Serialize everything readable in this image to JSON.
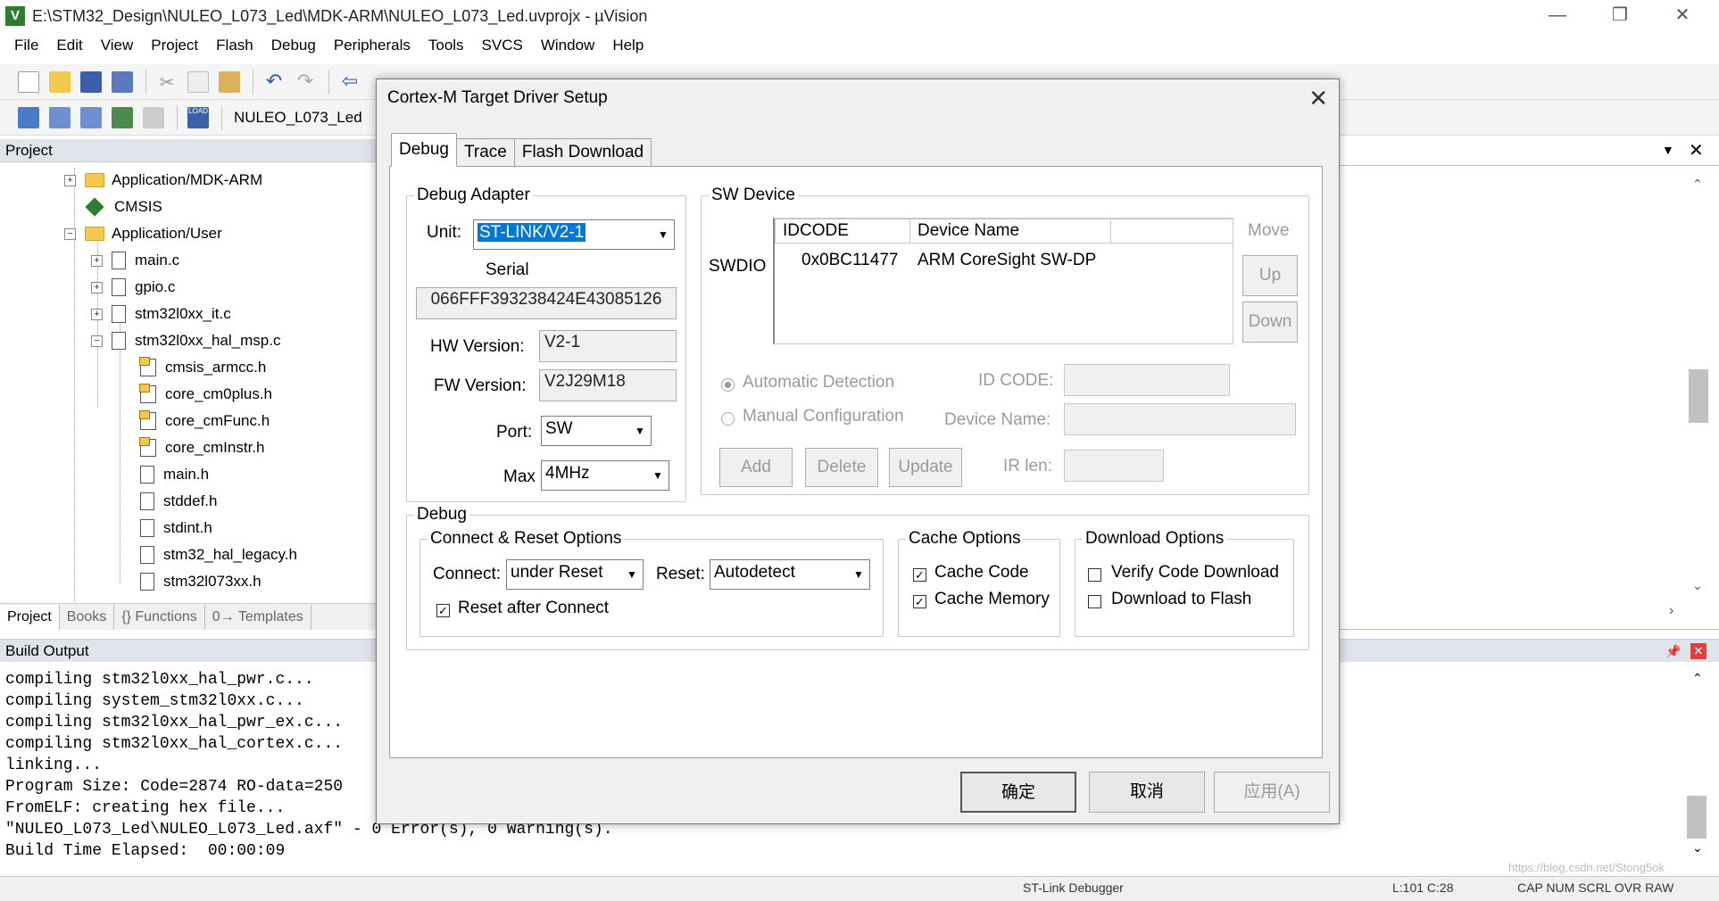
{
  "window": {
    "title": "E:\\STM32_Design\\NULEO_L073_Led\\MDK-ARM\\NULEO_L073_Led.uvprojx - µVision"
  },
  "menu": [
    "File",
    "Edit",
    "View",
    "Project",
    "Flash",
    "Debug",
    "Peripherals",
    "Tools",
    "SVCS",
    "Window",
    "Help"
  ],
  "toolbar": {
    "target": "NULEO_L073_Led"
  },
  "project": {
    "header": "Project",
    "tree": [
      "Application/MDK-ARM",
      "CMSIS",
      "Application/User",
      "main.c",
      "gpio.c",
      "stm32l0xx_it.c",
      "stm32l0xx_hal_msp.c",
      "cmsis_armcc.h",
      "core_cm0plus.h",
      "core_cmFunc.h",
      "core_cmInstr.h",
      "main.h",
      "stddef.h",
      "stdint.h",
      "stm32_hal_legacy.h",
      "stm32l073xx.h"
    ],
    "tabs": [
      "Project",
      "Books",
      "{} Functions",
      "0→ Templates"
    ]
  },
  "build": {
    "header": "Build Output",
    "lines": [
      "compiling stm32l0xx_hal_pwr.c...",
      "compiling system_stm32l0xx.c...",
      "compiling stm32l0xx_hal_pwr_ex.c...",
      "compiling stm32l0xx_hal_cortex.c...",
      "linking...",
      "Program Size: Code=2874 RO-data=250",
      "FromELF: creating hex file...",
      "\"NULEO_L073_Led\\NULEO_L073_Led.axf\" - 0 Error(s), 0 Warning(s).",
      "Build Time Elapsed:  00:00:09"
    ]
  },
  "status": {
    "debugger": "ST-Link Debugger",
    "pos": "L:101 C:28",
    "flags": "CAP  NUM  SCRL  OVR  RAW",
    "watermark": "https://blog.csdn.net/Stong5ok"
  },
  "dialog": {
    "title": "Cortex-M Target Driver Setup",
    "close": "✕",
    "tabs": [
      "Debug",
      "Trace",
      "Flash Download"
    ],
    "adapter": {
      "group": "Debug Adapter",
      "unit_label": "Unit:",
      "unit_value": "ST-LINK/V2-1",
      "serial_label": "Serial",
      "serial_value": "066FFF393238424E43085126",
      "hw_label": "HW Version:",
      "hw_value": "V2-1",
      "fw_label": "FW Version:",
      "fw_value": "V2J29M18",
      "port_label": "Port:",
      "port_value": "SW",
      "max_label": "Max",
      "max_value": "4MHz"
    },
    "sw_device": {
      "group": "SW Device",
      "swdio": "SWDIO",
      "col_idcode": "IDCODE",
      "col_name": "Device Name",
      "idcode": "0x0BC11477",
      "device_name": "ARM CoreSight SW-DP",
      "move": "Move",
      "up": "Up",
      "down": "Down",
      "auto": "Automatic Detection",
      "manual": "Manual Configuration",
      "id_code_label": "ID CODE:",
      "device_name_label": "Device Name:",
      "ir_len_label": "IR len:",
      "add": "Add",
      "delete": "Delete",
      "update": "Update"
    },
    "debug": {
      "group": "Debug",
      "connect_group": "Connect & Reset Options",
      "connect_label": "Connect:",
      "connect_value": "under Reset",
      "reset_label": "Reset:",
      "reset_value": "Autodetect",
      "reset_after": "Reset after Connect",
      "cache_group": "Cache Options",
      "cache_code": "Cache Code",
      "cache_memory": "Cache Memory",
      "download_group": "Download Options",
      "verify": "Verify Code Download",
      "download_flash": "Download to Flash"
    },
    "ok": "确定",
    "cancel": "取消",
    "apply": "应用(A)"
  }
}
